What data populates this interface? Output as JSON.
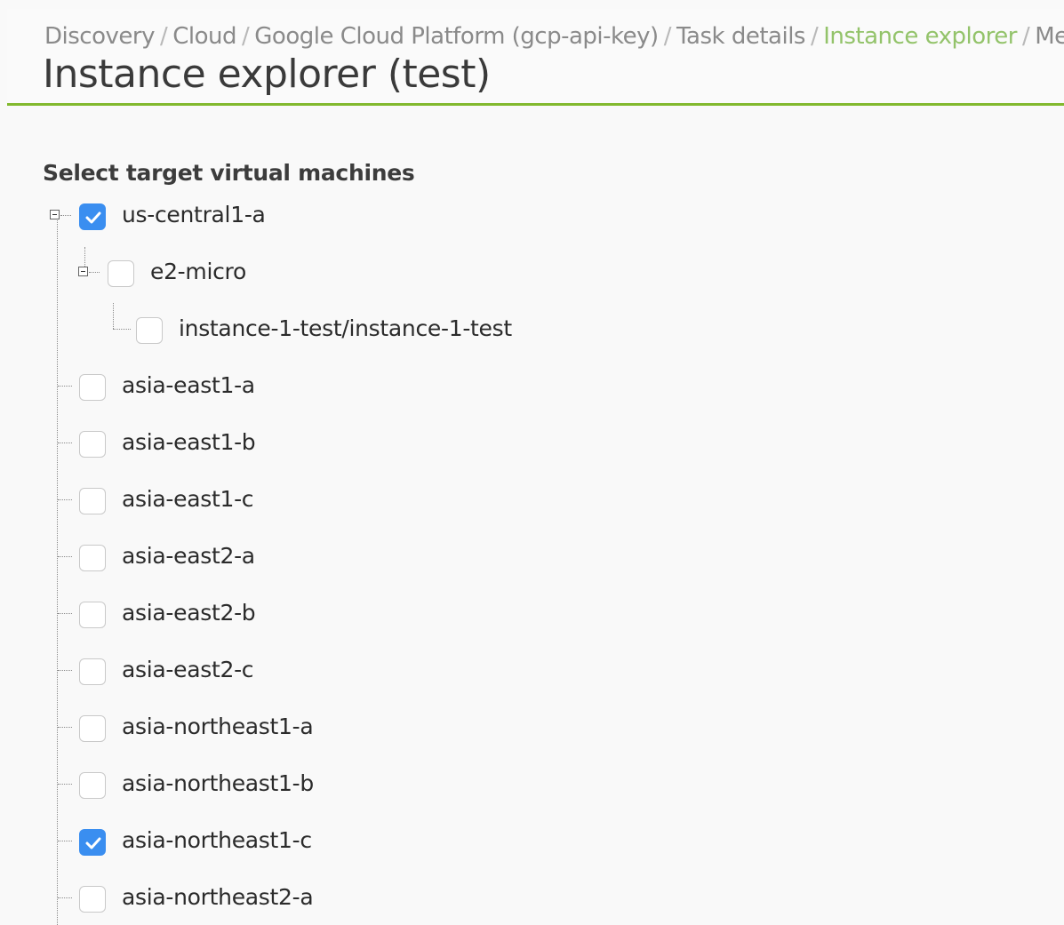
{
  "breadcrumb": {
    "items": [
      {
        "label": "Discovery"
      },
      {
        "label": "Cloud"
      },
      {
        "label": "Google Cloud Platform (gcp-api-key)"
      },
      {
        "label": "Task details"
      },
      {
        "label": "Instance explorer",
        "active": true
      },
      {
        "label": "Metrics"
      }
    ],
    "separator": "/"
  },
  "page": {
    "title": "Instance explorer (test)"
  },
  "selector": {
    "label": "Select target virtual machines",
    "nodes": [
      {
        "label": "us-central1-a",
        "checked": true,
        "expanded": true
      },
      {
        "label": "e2-micro",
        "checked": false,
        "expanded": true
      },
      {
        "label": "instance-1-test/instance-1-test",
        "checked": false
      },
      {
        "label": "asia-east1-a",
        "checked": false
      },
      {
        "label": "asia-east1-b",
        "checked": false
      },
      {
        "label": "asia-east1-c",
        "checked": false
      },
      {
        "label": "asia-east2-a",
        "checked": false
      },
      {
        "label": "asia-east2-b",
        "checked": false
      },
      {
        "label": "asia-east2-c",
        "checked": false
      },
      {
        "label": "asia-northeast1-a",
        "checked": false
      },
      {
        "label": "asia-northeast1-b",
        "checked": false
      },
      {
        "label": "asia-northeast1-c",
        "checked": true
      },
      {
        "label": "asia-northeast2-a",
        "checked": false
      }
    ]
  },
  "colors": {
    "accent": "#82b92e",
    "active_crumb": "#93c36a",
    "checkbox_checked": "#3a8ef0"
  }
}
